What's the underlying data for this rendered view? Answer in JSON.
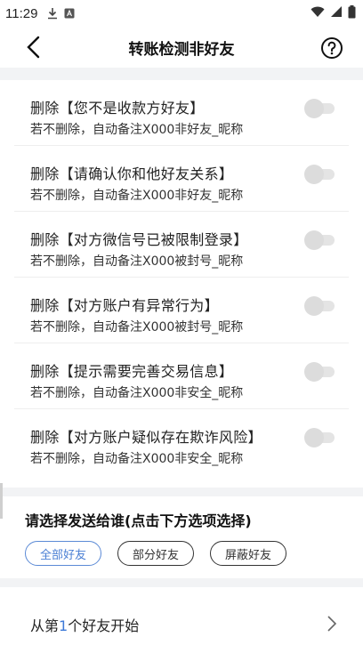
{
  "status_bar": {
    "time": "11:29"
  },
  "header": {
    "title": "转账检测非好友"
  },
  "options": [
    {
      "title": "删除【您不是收款方好友】",
      "subtitle": "若不删除，自动备注X000非好友_昵称",
      "enabled": false
    },
    {
      "title": "删除【请确认你和他好友关系】",
      "subtitle": "若不删除，自动备注X000非好友_昵称",
      "enabled": false
    },
    {
      "title": "删除【对方微信号已被限制登录】",
      "subtitle": "若不删除，自动备注X000被封号_昵称",
      "enabled": false
    },
    {
      "title": "删除【对方账户有异常行为】",
      "subtitle": "若不删除，自动备注X000被封号_昵称",
      "enabled": false
    },
    {
      "title": "删除【提示需要完善交易信息】",
      "subtitle": "若不删除，自动备注X000非安全_昵称",
      "enabled": false
    },
    {
      "title": "删除【对方账户疑似存在欺诈风险】",
      "subtitle": "若不删除，自动备注X000非安全_昵称",
      "enabled": false
    }
  ],
  "send_target": {
    "title": "请选择发送给谁(点击下方选项选择)",
    "chips": [
      {
        "label": "全部好友",
        "selected": true
      },
      {
        "label": "部分好友",
        "selected": false
      },
      {
        "label": "屏蔽好友",
        "selected": false
      }
    ]
  },
  "start_from": {
    "prefix": "从第",
    "number": "1",
    "suffix": "个好友开始"
  },
  "colors": {
    "accent": "#4a7fd4",
    "band": "#f2f3f5",
    "toggle_off": "#dcdcdc"
  }
}
